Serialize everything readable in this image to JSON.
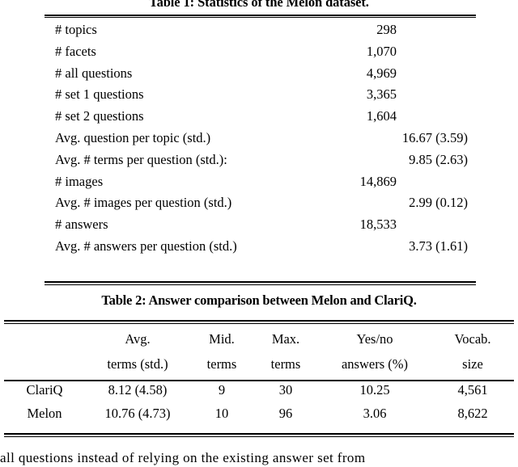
{
  "page": {
    "background": "#ffffff",
    "text_color": "#000000"
  },
  "table1": {
    "caption": "Table 1: Statistics of the Melon dataset.",
    "rows": [
      {
        "label": "# topics",
        "value": "298",
        "align": "mid"
      },
      {
        "label": "# facets",
        "value": "1,070",
        "align": "mid"
      },
      {
        "label": "# all questions",
        "value": "4,969",
        "align": "mid"
      },
      {
        "label": "# set 1 questions",
        "value": "3,365",
        "align": "mid"
      },
      {
        "label": "# set 2 questions",
        "value": "1,604",
        "align": "mid"
      },
      {
        "label": "Avg. question per topic (std.)",
        "value": "16.67 (3.59)",
        "align": "right"
      },
      {
        "label": "Avg. # terms per question (std.):",
        "value": "9.85 (2.63)",
        "align": "right"
      },
      {
        "label": "# images",
        "value": "14,869",
        "align": "mid"
      },
      {
        "label": "Avg. # images per question (std.)",
        "value": "2.99 (0.12)",
        "align": "right"
      },
      {
        "label": "# answers",
        "value": "18,533",
        "align": "mid"
      },
      {
        "label": "Avg. # answers per question (std.)",
        "value": "3.73 (1.61)",
        "align": "right"
      }
    ]
  },
  "table2": {
    "caption": "Table 2: Answer comparison between Melon and ClariQ.",
    "headers": [
      {
        "line1": "",
        "line2": ""
      },
      {
        "line1": "Avg.",
        "line2": "terms (std.)"
      },
      {
        "line1": "Mid.",
        "line2": "terms"
      },
      {
        "line1": "Max.",
        "line2": "terms"
      },
      {
        "line1": "Yes/no",
        "line2": "answers (%)"
      },
      {
        "line1": "Vocab.",
        "line2": "size"
      }
    ],
    "rows": [
      {
        "name": "ClariQ",
        "avg_terms_std": "8.12 (4.58)",
        "mid_terms": "9",
        "max_terms": "30",
        "yesno_answers_pct": "10.25",
        "vocab_size": "4,561"
      },
      {
        "name": "Melon",
        "avg_terms_std": "10.76 (4.73)",
        "mid_terms": "10",
        "max_terms": "96",
        "yesno_answers_pct": "3.06",
        "vocab_size": "8,622"
      }
    ]
  },
  "body": {
    "line": "all questions instead of relying on the existing answer set from"
  }
}
